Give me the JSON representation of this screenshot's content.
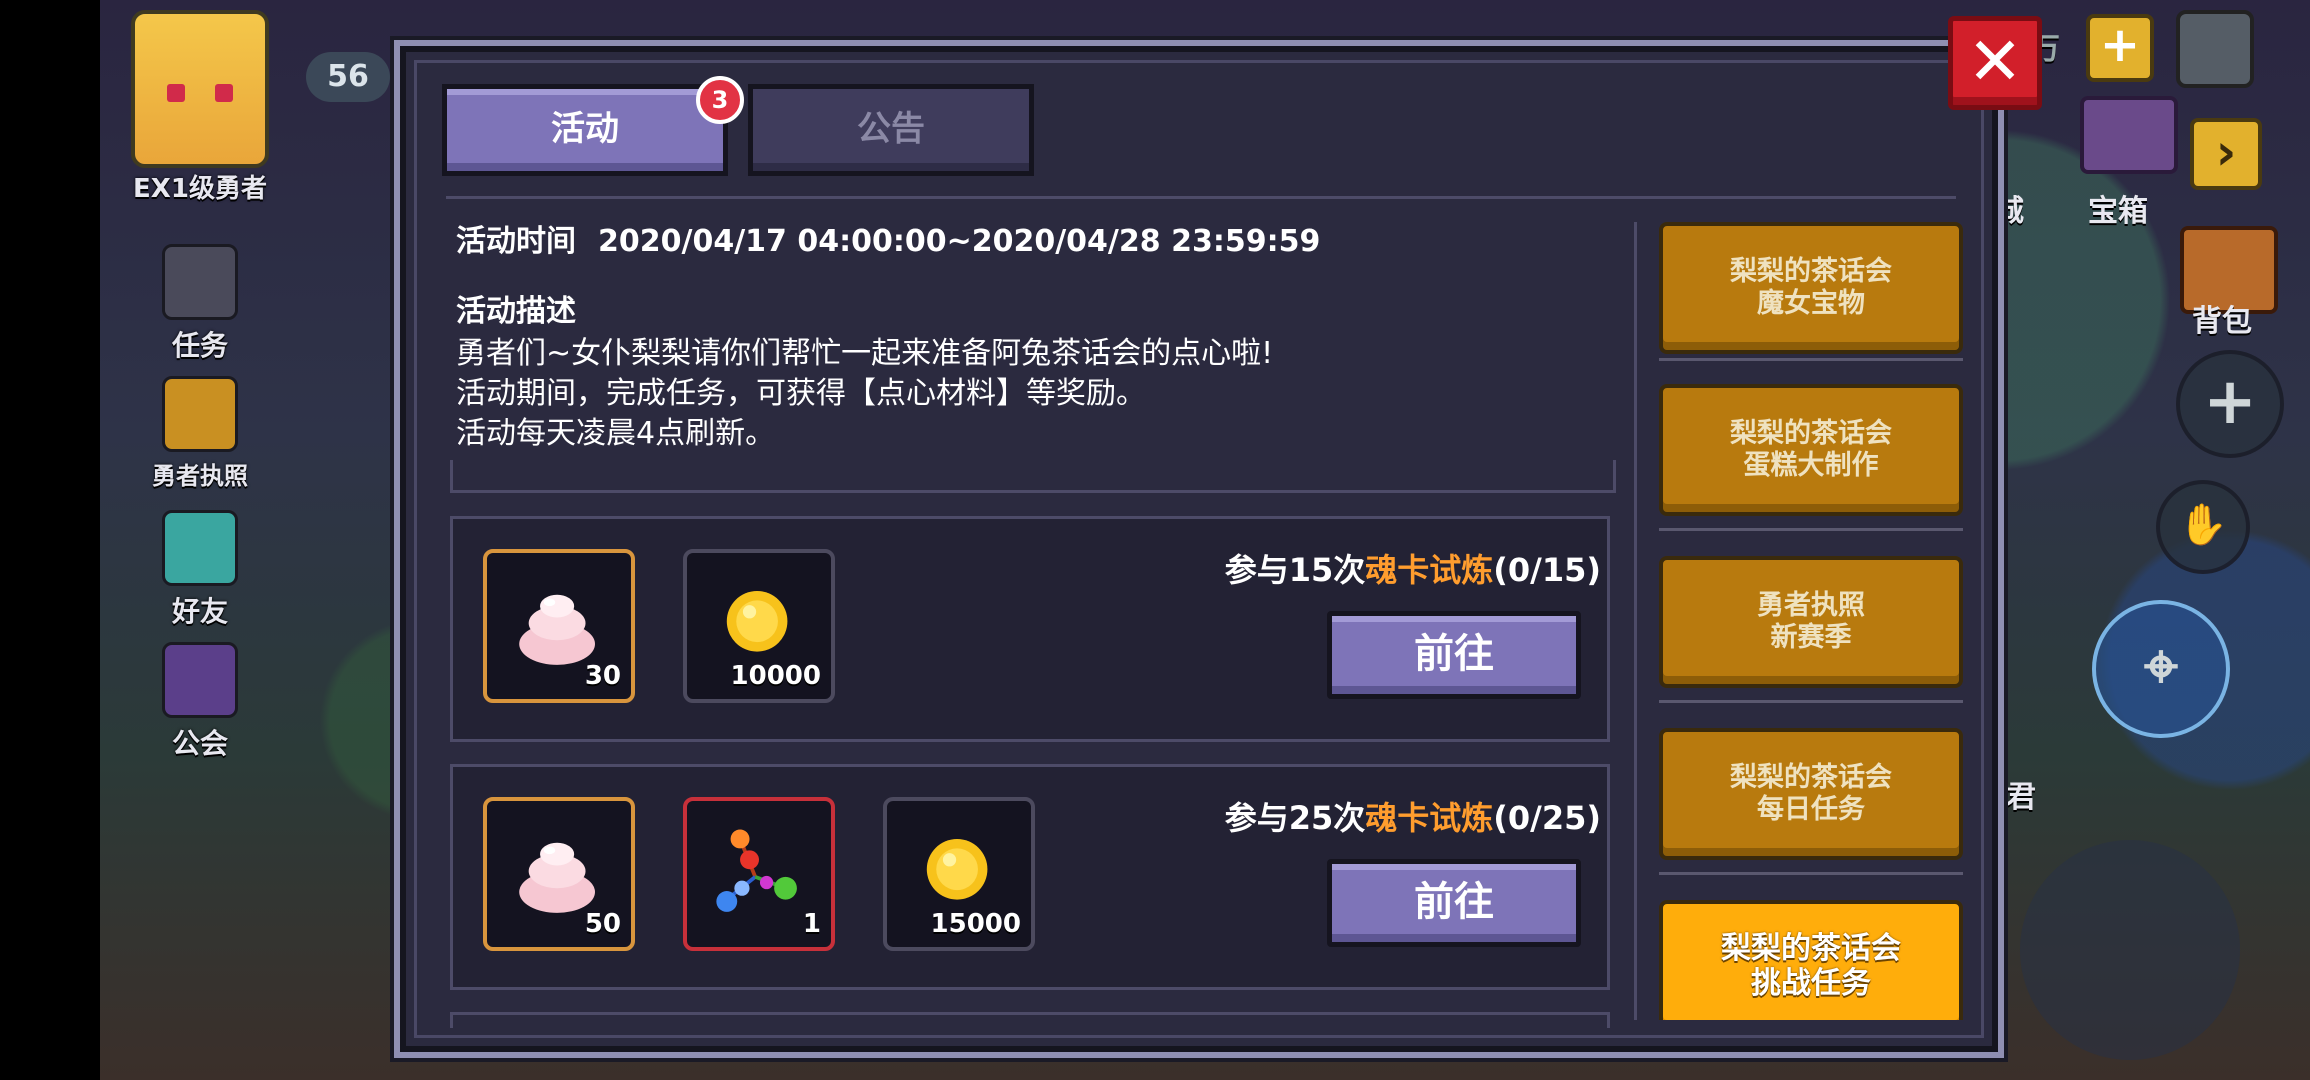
{
  "hud_left": {
    "level_badge": "56",
    "items": [
      {
        "label": "EX1级勇者"
      },
      {
        "label": "任务"
      },
      {
        "label": "勇者执照"
      },
      {
        "label": "好友"
      },
      {
        "label": "公会"
      }
    ]
  },
  "hud_right": {
    "currency_unit": "万",
    "chest_label": "宝箱",
    "bag_label": "背包",
    "partial_left_text": "城",
    "partial_right_text": "君"
  },
  "tabs": [
    {
      "label": "活动",
      "active": true,
      "badge": "3"
    },
    {
      "label": "公告",
      "active": false
    }
  ],
  "activity": {
    "time_label": "活动时间",
    "time_value": "2020/04/17 04:00:00~2020/04/28 23:59:59",
    "desc_title": "活动描述",
    "desc_lines": [
      "勇者们~女仆梨梨请你们帮忙一起来准备阿兔茶话会的点心啦!",
      "活动期间，完成任务，可获得【点心材料】等奖励。",
      "活动每天凌晨4点刷新。"
    ]
  },
  "tasks": [
    {
      "prefix": "参与15次",
      "highlight": "魂卡试炼",
      "progress": "(0/15)",
      "button": "前往",
      "rewards": [
        {
          "icon": "cream-icon",
          "count": "30",
          "frame": "gold"
        },
        {
          "icon": "gold-coin-icon",
          "count": "10000",
          "frame": "gray"
        }
      ]
    },
    {
      "prefix": "参与25次",
      "highlight": "魂卡试炼",
      "progress": "(0/25)",
      "button": "前往",
      "rewards": [
        {
          "icon": "cream-icon",
          "count": "50",
          "frame": "gold"
        },
        {
          "icon": "gem-cluster-icon",
          "count": "1",
          "frame": "red"
        },
        {
          "icon": "gold-coin-icon",
          "count": "15000",
          "frame": "gray"
        }
      ]
    }
  ],
  "side_events": [
    {
      "line1": "梨梨的茶话会",
      "line2": "魔女宝物",
      "active": false
    },
    {
      "line1": "梨梨的茶话会",
      "line2": "蛋糕大制作",
      "active": false
    },
    {
      "line1": "勇者执照",
      "line2": "新赛季",
      "active": false
    },
    {
      "line1": "梨梨的茶话会",
      "line2": "每日任务",
      "active": false
    },
    {
      "line1": "梨梨的茶话会",
      "line2": "挑战任务",
      "active": true
    }
  ],
  "colors": {
    "accent_purple": "#7e74b8",
    "highlight_orange": "#ff9d2e",
    "side_button": "#b87a0e",
    "side_button_active": "#ffad0b",
    "close_red": "#d21f2a"
  }
}
